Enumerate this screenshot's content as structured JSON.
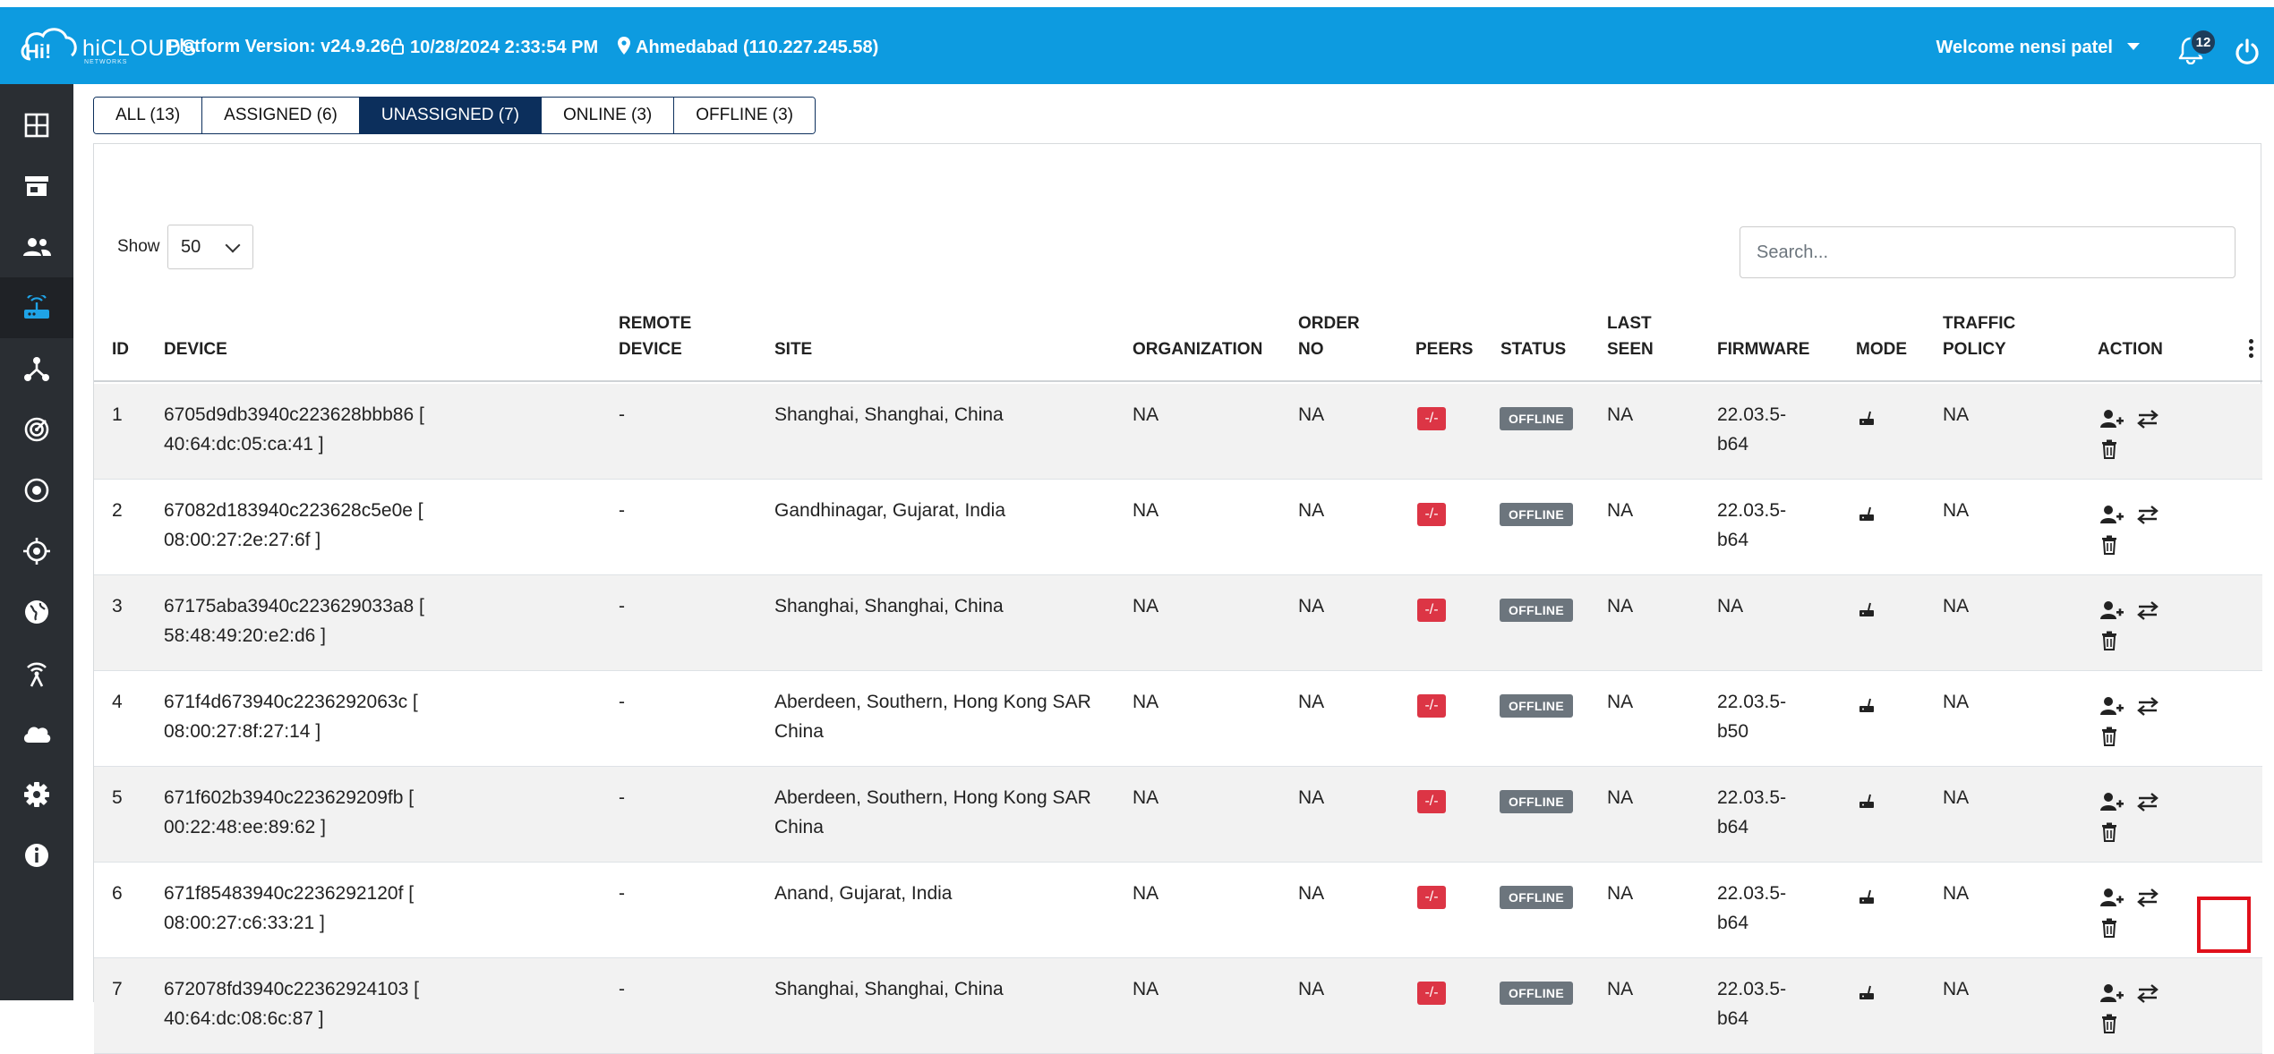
{
  "header": {
    "logo_text": "hiCLOUDS",
    "logo_sub": "NETWORKS",
    "platform_version": "Platform Version: v24.9.26",
    "datetime": "10/28/2024 2:33:54 PM",
    "location": "Ahmedabad (110.227.245.58)",
    "welcome": "Welcome nensi patel",
    "notification_count": "12",
    "bg_color": "#0d9be0"
  },
  "sidebar": {
    "items": [
      {
        "icon": "dashboard-grid-icon"
      },
      {
        "icon": "store-icon"
      },
      {
        "icon": "users-icon"
      },
      {
        "icon": "router-icon",
        "active": true
      },
      {
        "icon": "network-topology-icon"
      },
      {
        "icon": "radar-icon"
      },
      {
        "icon": "target-circle-icon"
      },
      {
        "icon": "crosshair-icon"
      },
      {
        "icon": "globe-icon"
      },
      {
        "icon": "wireless-tower-icon"
      },
      {
        "icon": "cloud-icon"
      },
      {
        "icon": "settings-gear-icon"
      },
      {
        "icon": "info-icon"
      }
    ]
  },
  "tabs": [
    {
      "label": "ALL (13)",
      "active": false
    },
    {
      "label": "ASSIGNED (6)",
      "active": false
    },
    {
      "label": "UNASSIGNED (7)",
      "active": true
    },
    {
      "label": "ONLINE (3)",
      "active": false
    },
    {
      "label": "OFFLINE (3)",
      "active": false
    }
  ],
  "controls": {
    "show_label": "Show",
    "page_size": "50",
    "search_placeholder": "Search..."
  },
  "table": {
    "headers": {
      "id": "ID",
      "device": "DEVICE",
      "remote_device_1": "REMOTE",
      "remote_device_2": "DEVICE",
      "site": "SITE",
      "organization": "ORGANIZATION",
      "order_no_1": "ORDER",
      "order_no_2": "NO",
      "peers": "PEERS",
      "status": "STATUS",
      "last_seen_1": "LAST",
      "last_seen_2": "SEEN",
      "firmware": "FIRMWARE",
      "mode": "MODE",
      "traffic_policy_1": "TRAFFIC",
      "traffic_policy_2": "POLICY",
      "action": "ACTION"
    },
    "rows": [
      {
        "id": "1",
        "device_1": "6705d9db3940c223628bbb86 [",
        "device_2": "40:64:dc:05:ca:41 ]",
        "remote": "-",
        "site_1": "Shanghai, Shanghai, China",
        "site_2": "",
        "org": "NA",
        "order": "NA",
        "peers": "-/-",
        "status": "OFFLINE",
        "last_seen": "NA",
        "fw_1": "22.03.5-",
        "fw_2": "b64",
        "policy": "NA"
      },
      {
        "id": "2",
        "device_1": "67082d183940c223628c5e0e [",
        "device_2": "08:00:27:2e:27:6f ]",
        "remote": "-",
        "site_1": "Gandhinagar, Gujarat, India",
        "site_2": "",
        "org": "NA",
        "order": "NA",
        "peers": "-/-",
        "status": "OFFLINE",
        "last_seen": "NA",
        "fw_1": "22.03.5-",
        "fw_2": "b64",
        "policy": "NA"
      },
      {
        "id": "3",
        "device_1": "67175aba3940c223629033a8 [",
        "device_2": "58:48:49:20:e2:d6 ]",
        "remote": "-",
        "site_1": "Shanghai, Shanghai, China",
        "site_2": "",
        "org": "NA",
        "order": "NA",
        "peers": "-/-",
        "status": "OFFLINE",
        "last_seen": "NA",
        "fw_1": "NA",
        "fw_2": "",
        "policy": "NA"
      },
      {
        "id": "4",
        "device_1": "671f4d673940c2236292063c [",
        "device_2": "08:00:27:8f:27:14 ]",
        "remote": "-",
        "site_1": "Aberdeen, Southern, Hong Kong SAR",
        "site_2": "China",
        "org": "NA",
        "order": "NA",
        "peers": "-/-",
        "status": "OFFLINE",
        "last_seen": "NA",
        "fw_1": "22.03.5-",
        "fw_2": "b50",
        "policy": "NA"
      },
      {
        "id": "5",
        "device_1": "671f602b3940c223629209fb [",
        "device_2": "00:22:48:ee:89:62 ]",
        "remote": "-",
        "site_1": "Aberdeen, Southern, Hong Kong SAR",
        "site_2": "China",
        "org": "NA",
        "order": "NA",
        "peers": "-/-",
        "status": "OFFLINE",
        "last_seen": "NA",
        "fw_1": "22.03.5-",
        "fw_2": "b64",
        "policy": "NA"
      },
      {
        "id": "6",
        "device_1": "671f85483940c2236292120f [",
        "device_2": "08:00:27:c6:33:21 ]",
        "remote": "-",
        "site_1": "Anand, Gujarat, India",
        "site_2": "",
        "org": "NA",
        "order": "NA",
        "peers": "-/-",
        "status": "OFFLINE",
        "last_seen": "NA",
        "fw_1": "22.03.5-",
        "fw_2": "b64",
        "policy": "NA"
      },
      {
        "id": "7",
        "device_1": "672078fd3940c22362924103 [",
        "device_2": "40:64:dc:08:6c:87 ]",
        "remote": "-",
        "site_1": "Shanghai, Shanghai, China",
        "site_2": "",
        "org": "NA",
        "order": "NA",
        "peers": "-/-",
        "status": "OFFLINE",
        "last_seen": "NA",
        "fw_1": "22.03.5-",
        "fw_2": "b64",
        "policy": "NA"
      }
    ]
  },
  "colors": {
    "active_tab": "#0c2f5c",
    "peers_badge": "#dc3545",
    "status_offline": "#6c757d",
    "highlight": "#e0101b"
  }
}
